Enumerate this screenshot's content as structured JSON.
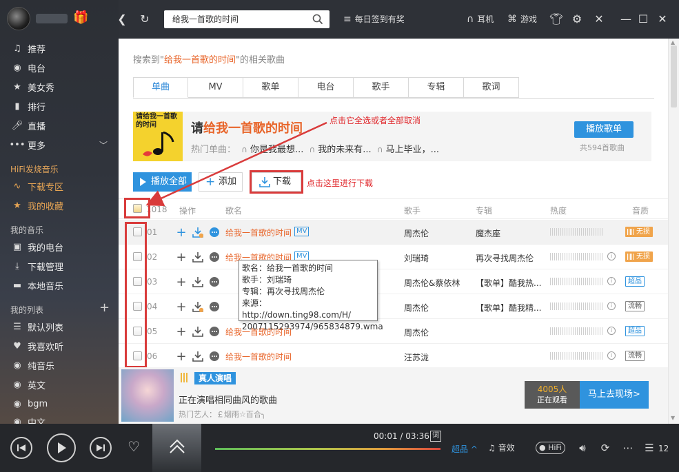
{
  "sidebar": {
    "items": [
      {
        "label": "推荐",
        "icon": "music-note-icon"
      },
      {
        "label": "电台",
        "icon": "radio-icon"
      },
      {
        "label": "美女秀",
        "icon": "star-icon"
      },
      {
        "label": "排行",
        "icon": "bar-chart-icon"
      },
      {
        "label": "直播",
        "icon": "microphone-icon"
      },
      {
        "label": "更多",
        "icon": "more-dots-icon"
      }
    ],
    "hifi_section": "HiFi发烧音乐",
    "hifi_items": [
      {
        "label": "下载专区",
        "icon": "waveform-icon"
      },
      {
        "label": "我的收藏",
        "icon": "star-icon"
      }
    ],
    "my_music_section": "我的音乐",
    "my_music_items": [
      {
        "label": "我的电台",
        "icon": "radio-icon"
      },
      {
        "label": "下载管理",
        "icon": "download-icon"
      },
      {
        "label": "本地音乐",
        "icon": "monitor-icon"
      }
    ],
    "my_list_section": "我的列表",
    "my_list_items": [
      {
        "label": "默认列表",
        "icon": "list-icon"
      },
      {
        "label": "我喜欢听",
        "icon": "heart-icon"
      },
      {
        "label": "纯音乐",
        "icon": "disc-icon"
      },
      {
        "label": "英文",
        "icon": "disc-icon"
      },
      {
        "label": "bgm",
        "icon": "disc-icon"
      },
      {
        "label": "中文",
        "icon": "disc-icon"
      }
    ]
  },
  "topbar": {
    "search_value": "给我一首歌的时间",
    "checkin": "每日签到有奖",
    "earphone": "耳机",
    "game": "游戏"
  },
  "search_result": {
    "prefix": "搜索到\"",
    "keyword": "给我一首歌的时间",
    "suffix": "\"的相关歌曲"
  },
  "tabs": [
    "单曲",
    "MV",
    "歌单",
    "电台",
    "歌手",
    "专辑",
    "歌词"
  ],
  "banner": {
    "cover_text": "请给我一首歌\n的时间",
    "title_prefix": "请",
    "title_hl": "给我一首歌的时间",
    "hot_label": "热门单曲：",
    "hot_songs": [
      "你是我最想...",
      "我的未来有...",
      "马上毕业，..."
    ],
    "play_button": "播放歌单",
    "count": "共594首歌曲"
  },
  "actions": {
    "play_all": "播放全部",
    "add": "添加",
    "download": "下载"
  },
  "annotations": {
    "select_all": "点击它全选或者全部取消",
    "download": "点击这里进行下载"
  },
  "table": {
    "total": "1018",
    "headers": {
      "op": "操作",
      "name": "歌名",
      "singer": "歌手",
      "album": "专辑",
      "heat": "热度",
      "quality": "音质"
    },
    "rows": [
      {
        "idx": "01",
        "name": "给我一首歌的时间",
        "mv": "MV",
        "singer": "周杰伦",
        "album": "魔杰座",
        "quality": "无损",
        "qtype": "lossless"
      },
      {
        "idx": "02",
        "name": "给我一首歌的时间",
        "mv": "MV",
        "singer": "刘瑞琦",
        "album": "再次寻找周杰伦",
        "quality": "无损",
        "qtype": "lossless"
      },
      {
        "idx": "03",
        "name": "",
        "mv": "",
        "singer": "周杰伦&蔡依林",
        "album": "【歌单】酷我热...",
        "quality": "超品",
        "qtype": "super"
      },
      {
        "idx": "04",
        "name": "",
        "mv": "",
        "singer": "周杰伦",
        "album": "【歌单】酷我精...",
        "quality": "流畅",
        "qtype": "smooth"
      },
      {
        "idx": "05",
        "name": "给我一首歌的时间",
        "mv": "",
        "singer": "周杰伦",
        "album": "",
        "quality": "超品",
        "qtype": "super"
      },
      {
        "idx": "06",
        "name": "给我一首歌的时间",
        "mv": "",
        "singer": "汪苏泷",
        "album": "",
        "quality": "流畅",
        "qtype": "smooth"
      }
    ]
  },
  "tooltip": {
    "line1": "歌名：给我一首歌的时间",
    "line2": "歌手：刘瑞琦",
    "line3": "专辑：再次寻找周杰伦",
    "line4": "来源：http://down.ting98.com/H/",
    "line5": "2007115293974/965834879.wma"
  },
  "live": {
    "badge": "真人演唱",
    "desc": "正在演唱相同曲风的歌曲",
    "artists": "热门艺人：￡烟雨☆百合╮",
    "viewers": "4005人",
    "viewers_label": "正在观看",
    "go": "马上去现场>"
  },
  "player": {
    "time": "00:01 / 03:36",
    "lyric": "词",
    "progress": 0.01,
    "quality": "超品",
    "effect": "音效",
    "hifi": "HiFi",
    "playlist_count": "12"
  }
}
